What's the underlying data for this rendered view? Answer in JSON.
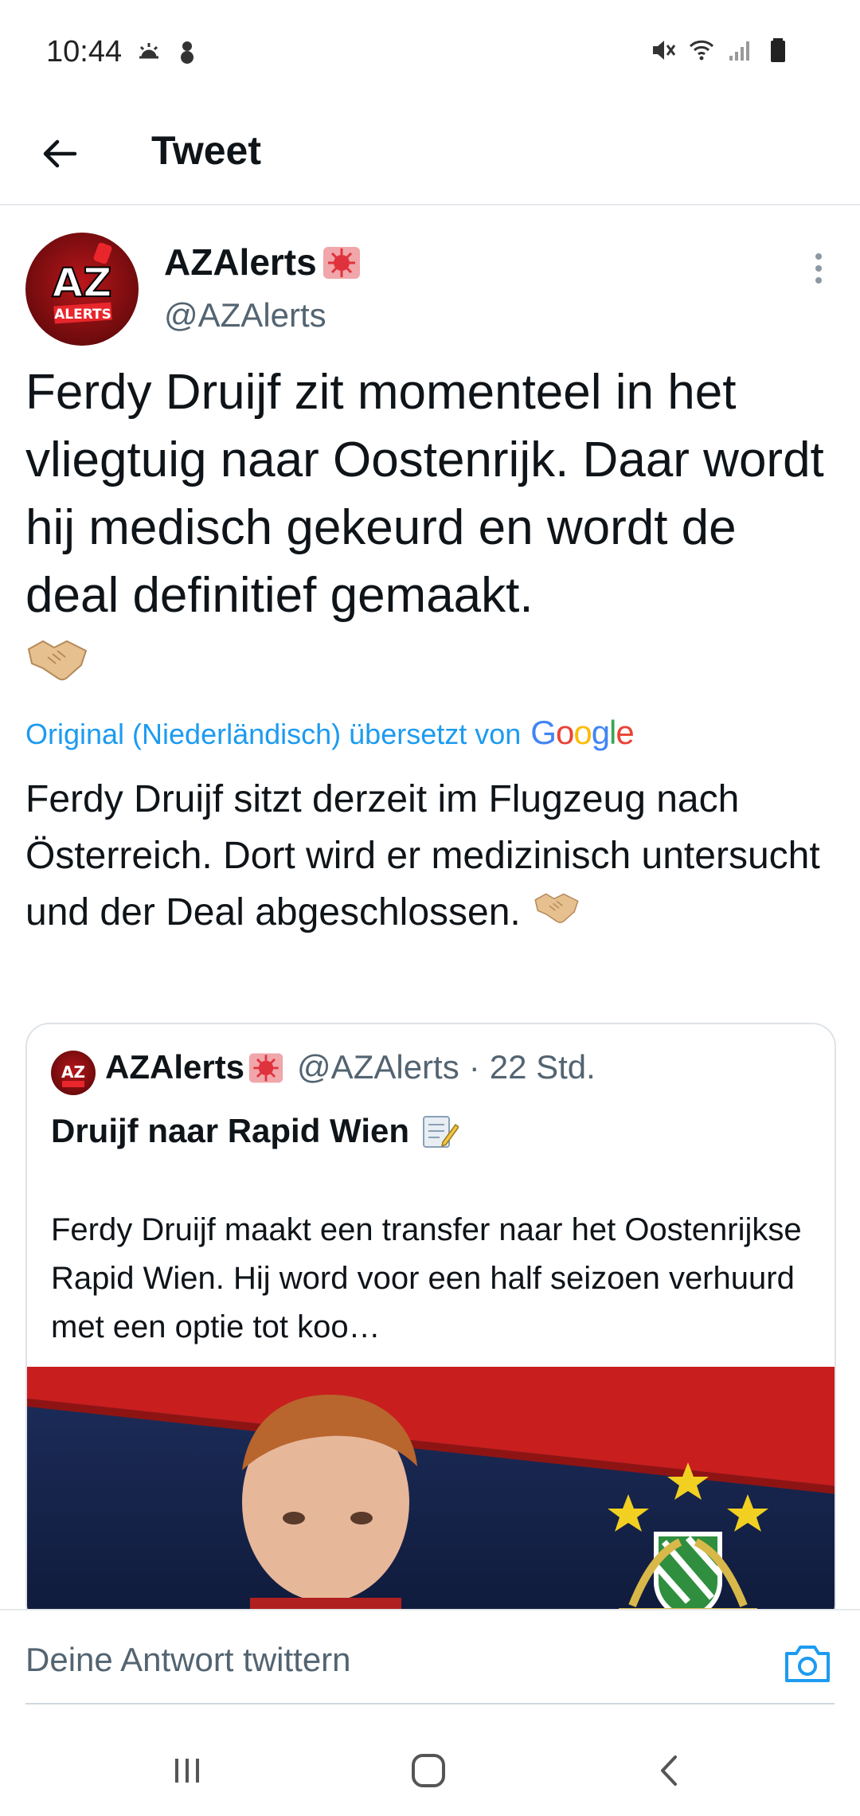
{
  "status_bar": {
    "time": "10:44"
  },
  "header": {
    "title": "Tweet"
  },
  "tweet": {
    "author_name": "AZAlerts",
    "author_handle": "@AZAlerts",
    "avatar_text_top": "AZ",
    "avatar_text_bottom": "ALERTS",
    "text": "Ferdy Druijf zit momenteel in het vliegtuig naar Oostenrijk. Daar wordt hij medisch gekeurd en wordt de deal definitief gemaakt.",
    "emoji": "🤝",
    "translation_label": "Original (Niederländisch) übersetzt von",
    "translation_provider": "Google",
    "translated_text": "Ferdy Druijf sitzt derzeit im Flugzeug nach Österreich. Dort wird er medizinisch untersucht und der Deal abgeschlossen."
  },
  "quoted_tweet": {
    "author_name": "AZAlerts",
    "author_handle": "@AZAlerts",
    "separator": "·",
    "time": "22 Std.",
    "title": "Druijf naar Rapid Wien",
    "text": "Ferdy Druijf maakt een transfer naar het Oostenrijkse Rapid Wien. Hij word voor een half seizoen verhuurd met een optie tot koo…"
  },
  "reply": {
    "placeholder": "Deine Antwort twittern"
  },
  "colors": {
    "link_blue": "#1d9bf0",
    "secondary_text": "#536471",
    "brand_red": "#b8161a"
  },
  "icons": {
    "back": "arrow-left-icon",
    "more": "more-vertical-icon",
    "camera": "camera-icon",
    "siren": "police-light-icon",
    "memo": "memo-icon",
    "handshake": "handshake-icon"
  }
}
